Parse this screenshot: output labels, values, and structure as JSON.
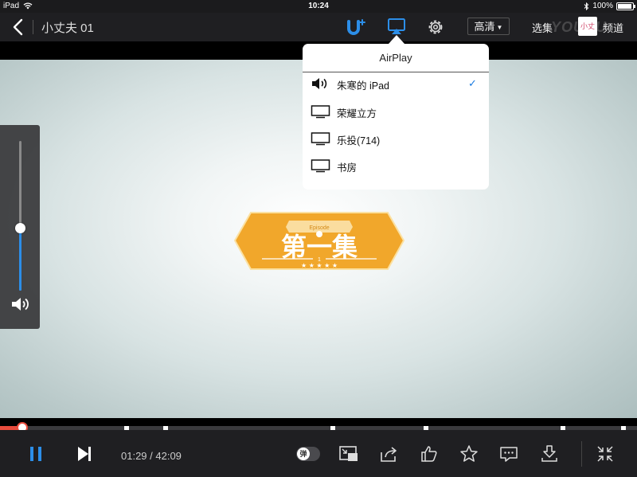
{
  "status_bar": {
    "device": "iPad",
    "time": "10:24",
    "battery": "100%"
  },
  "top_bar": {
    "title": "小丈夫 01",
    "quality_label": "高清",
    "episodes_label": "选集",
    "watermark": "YOUKU",
    "channel_thumb_text": "小丈夫",
    "channel_label": "频道"
  },
  "airplay": {
    "title": "AirPlay",
    "devices": [
      {
        "label": "朱寒的 iPad",
        "selected": true
      },
      {
        "label": "荣耀立方",
        "selected": false
      },
      {
        "label": "乐投(714)",
        "selected": false
      },
      {
        "label": "书房",
        "selected": false
      }
    ],
    "check_glyph": "✓"
  },
  "video": {
    "badge_small": "Episode",
    "badge_title": "第一集",
    "badge_number": "1"
  },
  "volume": {
    "level": 0.42
  },
  "playback": {
    "current": "01:29",
    "total": "42:09",
    "time_text": "01:29 / 42:09",
    "progress": 0.035,
    "danmu_label": "弹"
  },
  "colors": {
    "accent_blue": "#2c8ee8",
    "progress_red": "#e84c3d",
    "badge_orange": "#f1a72b"
  }
}
